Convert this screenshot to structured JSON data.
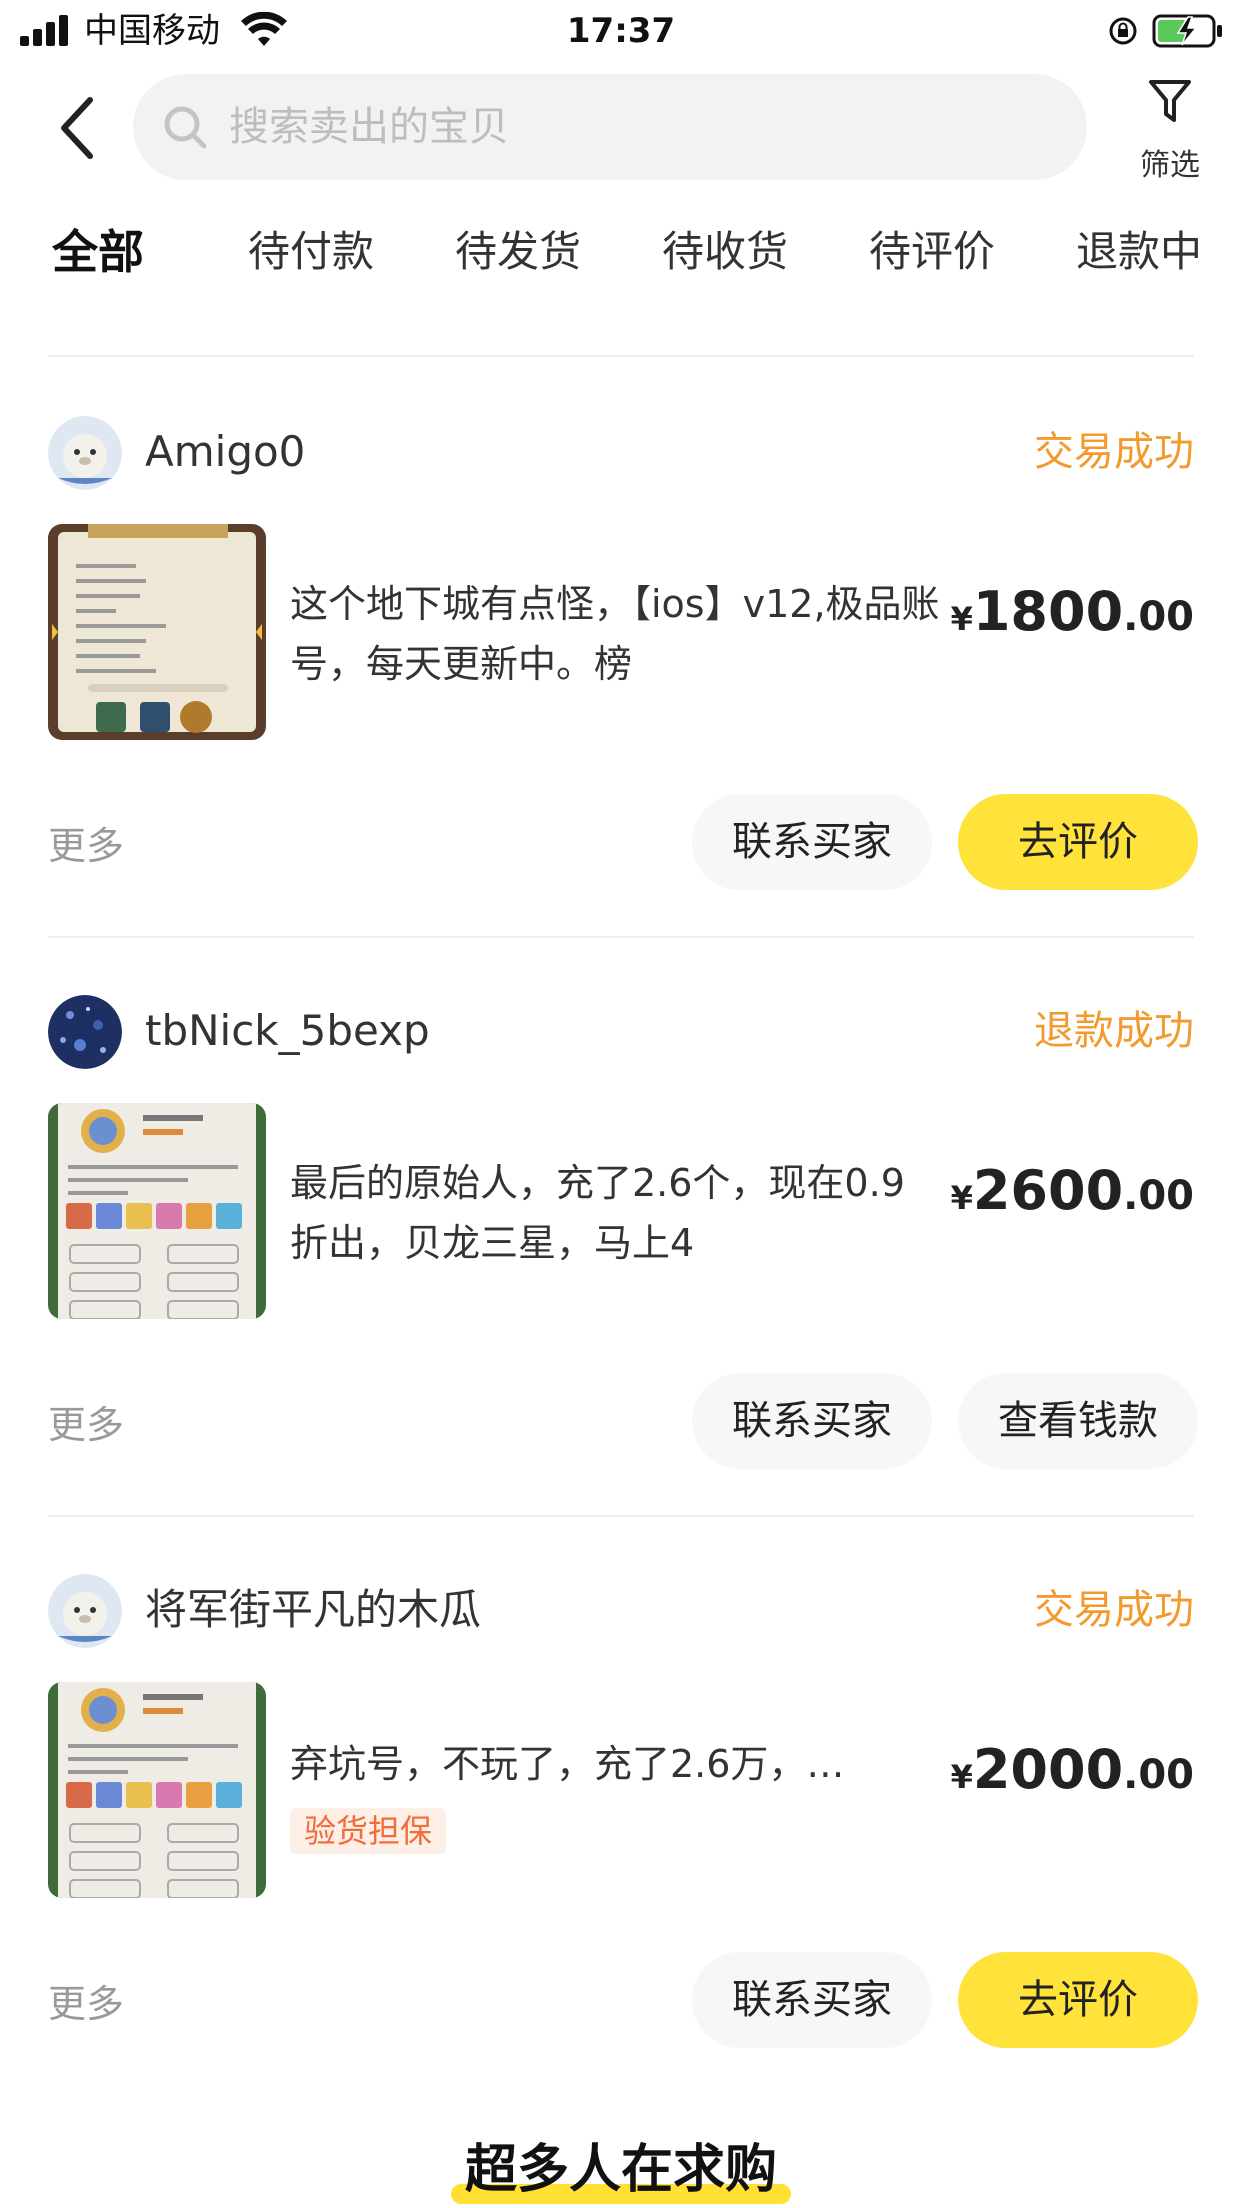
{
  "status_bar": {
    "carrier": "中国移动",
    "time": "17:37"
  },
  "header": {
    "search_placeholder": "搜索卖出的宝贝",
    "filter_label": "筛选"
  },
  "tabs": [
    {
      "label": "全部",
      "active": true
    },
    {
      "label": "待付款"
    },
    {
      "label": "待发货"
    },
    {
      "label": "待收货"
    },
    {
      "label": "待评价"
    },
    {
      "label": "退款中"
    }
  ],
  "orders": [
    {
      "buyer": "Amigo0",
      "status": "交易成功",
      "title": "这个地下城有点怪，【ios】v12,极品账号，每天更新中。榜",
      "price_yen": "¥",
      "price_int": "1800",
      "price_dec": ".00",
      "more": "更多",
      "contact_label": "联系买家",
      "action_label": "去评价"
    },
    {
      "buyer": "tbNick_5bexp",
      "status": "退款成功",
      "title": "最后的原始人，充了2.6个，现在0.9折出，贝龙三星，马上4",
      "price_yen": "¥",
      "price_int": "2600",
      "price_dec": ".00",
      "more": "更多",
      "contact_label": "联系买家",
      "action_label": "查看钱款"
    },
    {
      "buyer": "将军街平凡的木瓜",
      "status": "交易成功",
      "title": "弃坑号，不玩了，充了2.6万，…",
      "tag": "验货担保",
      "price_yen": "¥",
      "price_int": "2000",
      "price_dec": ".00",
      "more": "更多",
      "contact_label": "联系买家",
      "action_label": "去评价"
    }
  ],
  "bottom_section": {
    "title": "超多人在求购"
  },
  "colors": {
    "accent_yellow": "#ffe33b",
    "status_orange": "#f39a2e",
    "tag_text": "#f16c3a",
    "tag_bg": "#fdeee6"
  },
  "icons": [
    "back-chevron-icon",
    "search-icon",
    "filter-funnel-icon",
    "signal-icon",
    "wifi-icon",
    "orientation-lock-icon",
    "battery-charging-icon"
  ]
}
